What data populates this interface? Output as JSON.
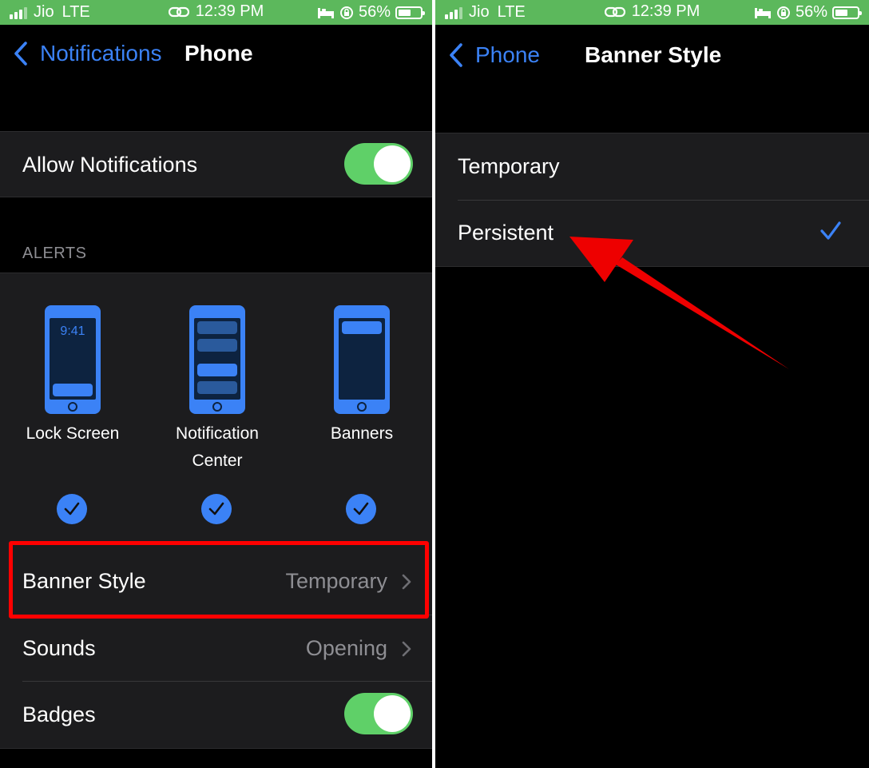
{
  "status_bar": {
    "carrier": "Jio",
    "network": "LTE",
    "time": "12:39 PM",
    "battery": "56%",
    "battery_level": 0.56,
    "background": "#5cb85c"
  },
  "left": {
    "back_label": "Notifications",
    "title": "Phone",
    "allow_notifications": {
      "label": "Allow Notifications",
      "on": true
    },
    "alerts_header": "ALERTS",
    "alert_styles": [
      {
        "label": "Lock Screen",
        "clock": "9:41",
        "checked": true
      },
      {
        "label": "Notification Center",
        "label_line1": "Notification",
        "label_line2": "Center",
        "checked": true
      },
      {
        "label": "Banners",
        "checked": true
      }
    ],
    "rows": {
      "banner_style": {
        "label": "Banner Style",
        "value": "Temporary"
      },
      "sounds": {
        "label": "Sounds",
        "value": "Opening"
      },
      "badges": {
        "label": "Badges",
        "on": true
      }
    }
  },
  "right": {
    "back_label": "Phone",
    "title": "Banner Style",
    "options": [
      {
        "label": "Temporary",
        "selected": false
      },
      {
        "label": "Persistent",
        "selected": true
      }
    ]
  },
  "colors": {
    "accent": "#3b82f6",
    "toggle_on": "#5fd068",
    "annotation": "#ff0000",
    "cell_background": "#1c1c1e"
  }
}
